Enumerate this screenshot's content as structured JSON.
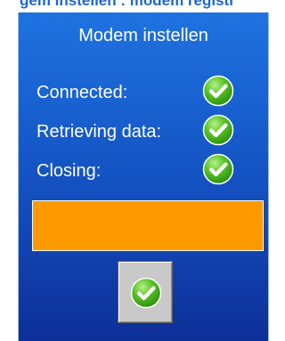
{
  "window": {
    "title": "Modem instellen",
    "titlebar_partial": "gem instellen : modem registr"
  },
  "dialog": {
    "heading": "Modem instellen",
    "status_rows": [
      {
        "label": "Connected:",
        "state": "done",
        "icon": "check-circle-icon"
      },
      {
        "label": "Retrieving data:",
        "state": "done",
        "icon": "check-circle-icon"
      },
      {
        "label": "Closing:",
        "state": "done",
        "icon": "check-circle-icon"
      }
    ],
    "progress": {
      "value": 1.0,
      "color": "#ff9900"
    },
    "ok_button": {
      "icon": "check-circle-icon"
    }
  },
  "colors": {
    "background_top": "#1e73e0",
    "background_bottom": "#0d2f98",
    "check_green": "#44b21c",
    "progress_orange": "#ff9900",
    "button_gray": "#c9c9c9"
  }
}
